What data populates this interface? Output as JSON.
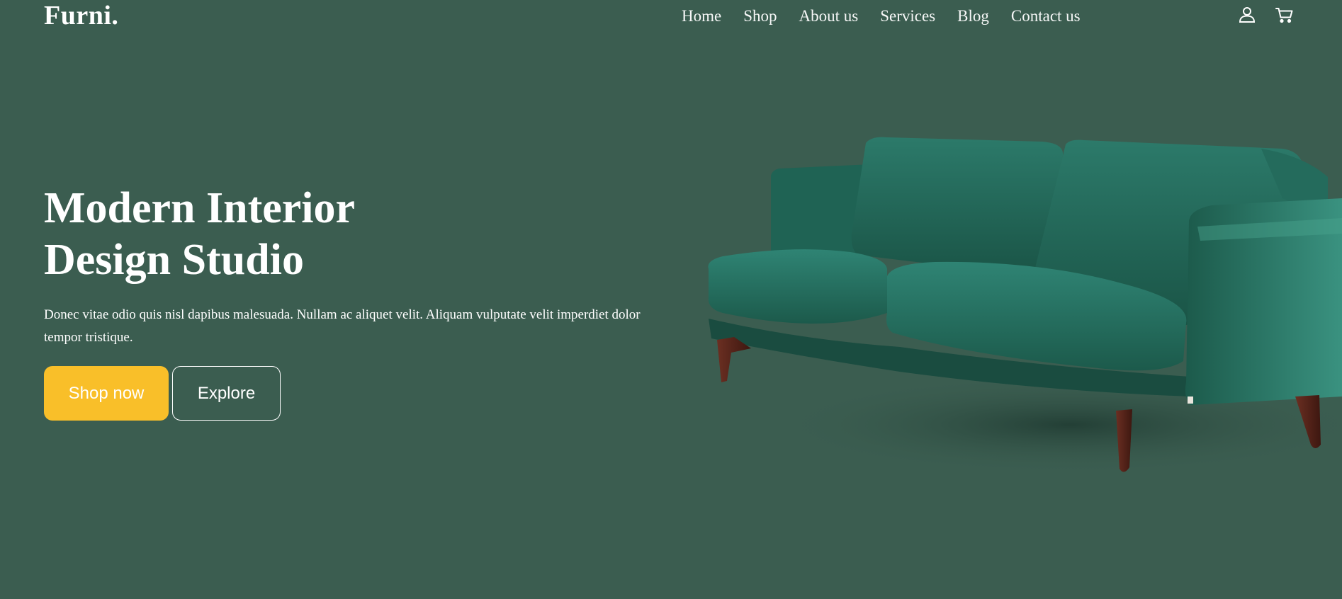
{
  "brand": {
    "name": "Furni."
  },
  "nav": {
    "items": [
      "Home",
      "Shop",
      "About us",
      "Services",
      "Blog",
      "Contact us"
    ]
  },
  "header_icons": {
    "user": "user-icon",
    "cart": "cart-icon"
  },
  "hero": {
    "title_line1": "Modern Interior",
    "title_line2": "Design Studio",
    "description": "Donec vitae odio quis nisl dapibus malesuada. Nullam ac aliquet velit. Aliquam vulputate velit imperdiet dolor tempor tristique.",
    "primary_button": "Shop now",
    "secondary_button": "Explore",
    "image": "green velvet sofa"
  },
  "colors": {
    "background": "#3b5d50",
    "accent": "#f9bf29",
    "text": "#ffffff"
  }
}
